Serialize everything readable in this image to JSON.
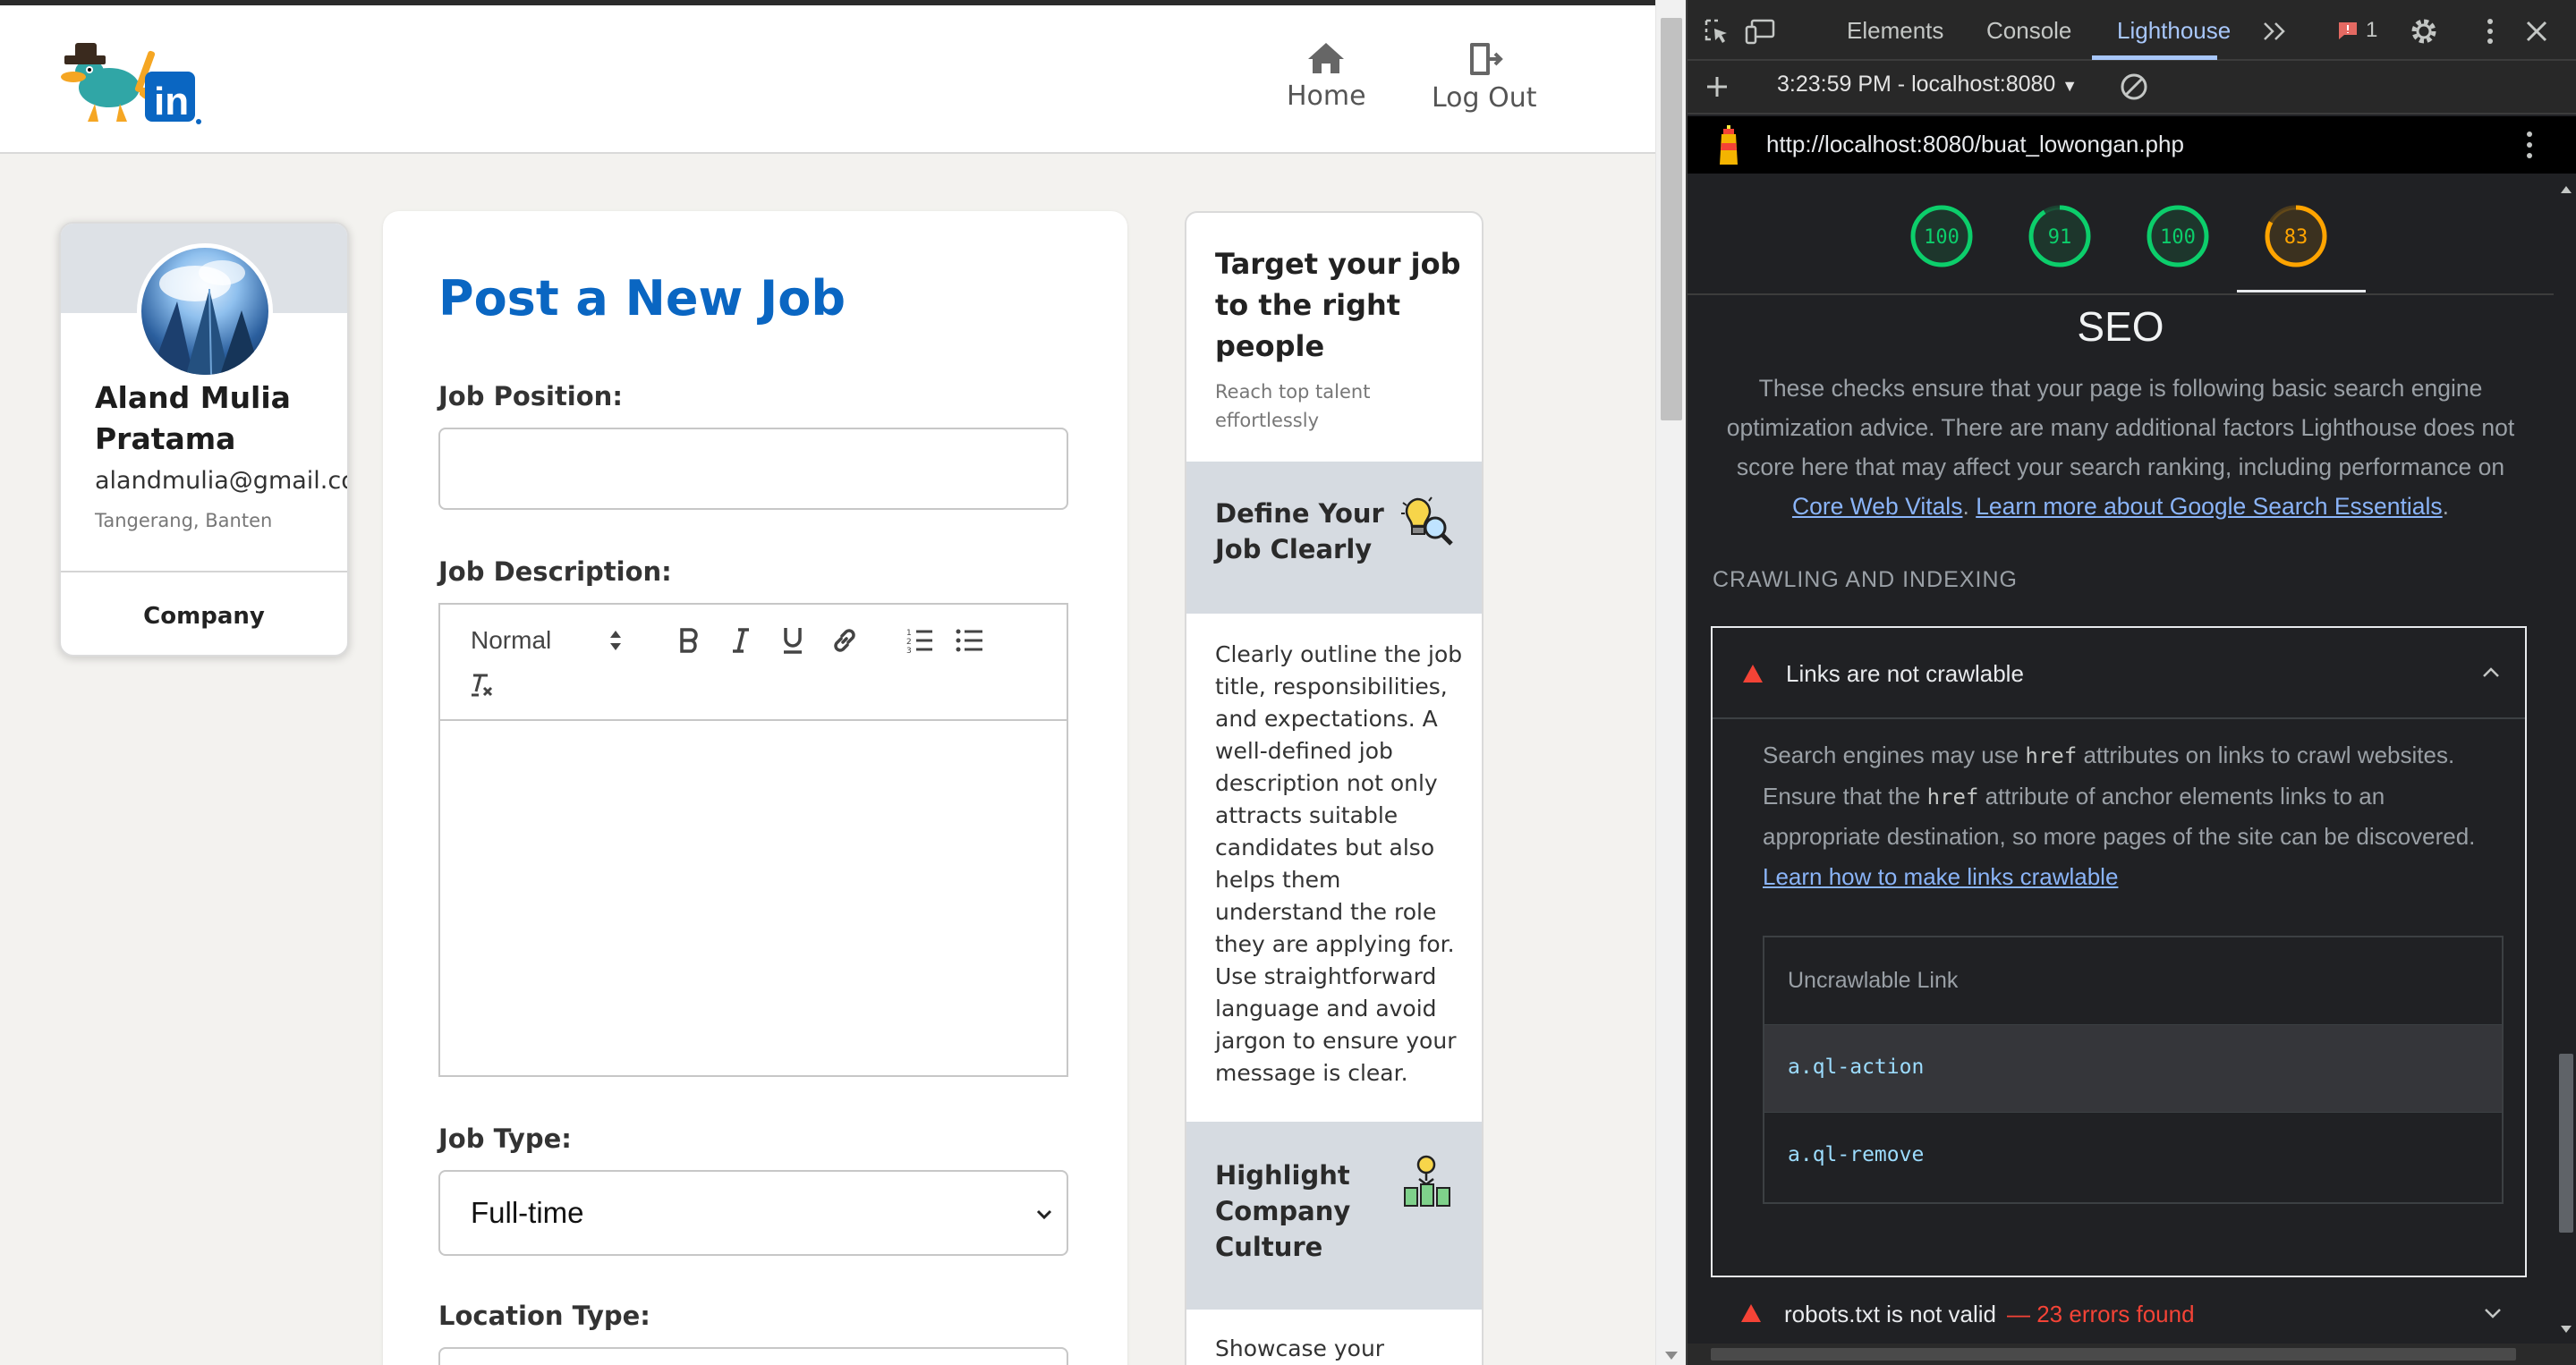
{
  "nav": {
    "home_label": "Home",
    "logout_label": "Log Out"
  },
  "profile": {
    "name": "Aland Mulia Pratama",
    "email": "alandmulia@gmail.com",
    "location": "Tangerang, Banten",
    "company_link": "Company"
  },
  "form": {
    "title": "Post a New Job",
    "position_label": "Job Position:",
    "position_value": "",
    "description_label": "Job Description:",
    "editor_header_value": "Normal",
    "jobtype_label": "Job Type:",
    "jobtype_value": "Full-time",
    "locationtype_label": "Location Type:"
  },
  "tips": {
    "heading": "Target your job to the right people",
    "subheading": "Reach top talent effortlessly",
    "items": [
      {
        "title": "Define Your Job Clearly",
        "icon": "lightbulb-magnifier-icon",
        "body": "Clearly outline the job title, responsibilities, and expectations. A well-defined job description not only attracts suitable candidates but also helps them understand the role they are applying for. Use straightforward language and avoid jargon to ensure your message is clear."
      },
      {
        "title": "Highlight Company Culture",
        "icon": "culture-icon",
        "body": "Showcase your"
      }
    ]
  },
  "devtools": {
    "tabs": [
      "Elements",
      "Console",
      "Lighthouse"
    ],
    "issues_count": "1",
    "report_select": "3:23:59 PM - localhost:8080",
    "url": "http://localhost:8080/buat_lowongan.php",
    "scores": [
      {
        "value": 100,
        "color": "#0cce6b"
      },
      {
        "value": 91,
        "color": "#0cce6b"
      },
      {
        "value": 100,
        "color": "#0cce6b"
      },
      {
        "value": 83,
        "color": "#ffa400"
      }
    ],
    "seo": {
      "title": "SEO",
      "desc_text": "These checks ensure that your page is following basic search engine optimization advice. There are many additional factors Lighthouse does not score here that may affect your search ranking, including performance on",
      "link1": "Core Web Vitals",
      "link2": "Learn more about Google Search Essentials",
      "section_heading": "CRAWLING AND INDEXING",
      "audit_title": "Links are not crawlable",
      "audit_desc_1": "Search engines may use",
      "audit_code_1": "href",
      "audit_desc_2": "attributes on links to crawl websites. Ensure that the",
      "audit_code_2": "href",
      "audit_desc_3": "attribute of anchor elements links to an appropriate destination, so more pages of the site can be discovered.",
      "audit_link": "Learn how to make links crawlable",
      "table_header": "Uncrawlable Link",
      "table_rows": [
        "a.ql-action",
        "a.ql-remove"
      ],
      "robots_title": "robots.txt is not valid",
      "robots_errors": "— 23 errors found"
    }
  }
}
